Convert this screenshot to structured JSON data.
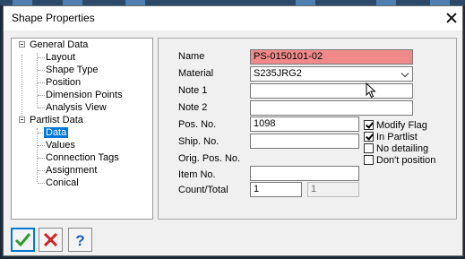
{
  "window": {
    "title": "Shape Properties"
  },
  "tree": {
    "groups": [
      {
        "label": "General Data",
        "items": [
          "Layout",
          "Shape Type",
          "Position",
          "Dimension Points",
          "Analysis View"
        ]
      },
      {
        "label": "Partlist Data",
        "items": [
          "Data",
          "Values",
          "Connection Tags",
          "Assignment",
          "Conical"
        ]
      }
    ],
    "selected": "Data"
  },
  "form": {
    "name_label": "Name",
    "name_value": "PS-0150101-02",
    "material_label": "Material",
    "material_value": "S235JRG2",
    "note1_label": "Note 1",
    "note1_value": "",
    "note2_label": "Note 2",
    "note2_value": "",
    "pos_no_label": "Pos. No.",
    "pos_no_value": "1098",
    "ship_no_label": "Ship. No.",
    "ship_no_value": "",
    "orig_pos_no_label": "Orig. Pos. No.",
    "item_no_label": "Item No.",
    "item_no_value": "",
    "count_total_label": "Count/Total",
    "count_value": "1",
    "total_value": "1"
  },
  "checkboxes": [
    {
      "label": "Modify Flag",
      "checked": true
    },
    {
      "label": "In Partlist",
      "checked": true
    },
    {
      "label": "No detailing",
      "checked": false
    },
    {
      "label": "Don't position",
      "checked": false
    }
  ],
  "buttons": {
    "ok_icon": "checkmark-icon",
    "cancel_icon": "cancel-x-icon",
    "help_icon": "help-question-icon"
  },
  "colors": {
    "highlight": "#f08a8a",
    "selection": "#0078d7",
    "ok_green": "#2e9b2e",
    "cancel_red": "#d42020",
    "help_blue": "#1c5fb8"
  }
}
